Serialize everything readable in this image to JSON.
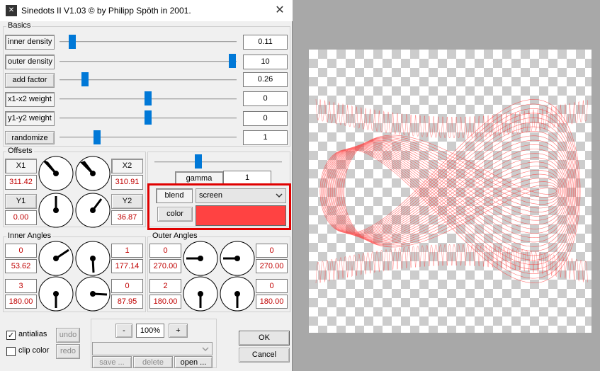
{
  "window": {
    "title": "Sinedots II V1.03 © by Philipp Spöth in 2001.",
    "close_glyph": "✕",
    "logo_glyph": "✕"
  },
  "basics": {
    "label": "Basics",
    "rows": [
      {
        "label": "inner density",
        "value": "0.11",
        "slider": 0.09
      },
      {
        "label": "outer density",
        "value": "10",
        "slider": 1.0
      },
      {
        "label": "add factor",
        "value": "0.26",
        "slider": 0.14
      },
      {
        "label": "x1-x2 weight",
        "value": "0",
        "slider": 0.5
      },
      {
        "label": "y1-y2 weight",
        "value": "0",
        "slider": 0.5
      },
      {
        "label": "randomize",
        "value": "1",
        "slider": 0.2
      }
    ]
  },
  "offsets": {
    "label": "Offsets",
    "x1": {
      "label": "X1",
      "value": "311.42"
    },
    "x2": {
      "label": "X2",
      "value": "310.91"
    },
    "y1": {
      "label": "Y1",
      "value": "0.00"
    },
    "y2": {
      "label": "Y2",
      "value": "36.87"
    }
  },
  "render": {
    "gamma": {
      "label": "gamma",
      "value": "1",
      "slider": 0.45
    },
    "blend": {
      "label": "blend",
      "value": "screen"
    },
    "color": {
      "label": "color",
      "swatch": "#ff4242"
    }
  },
  "inner_angles": {
    "label": "Inner Angles",
    "items": [
      {
        "index": "0",
        "value": "53.62"
      },
      {
        "index": "1",
        "value": "177.14"
      },
      {
        "index": "3",
        "value": "180.00"
      },
      {
        "index": "0",
        "value": "87.95"
      }
    ]
  },
  "outer_angles": {
    "label": "Outer Angles",
    "items": [
      {
        "index": "0",
        "value": "270.00"
      },
      {
        "index": "0",
        "value": "270.00"
      },
      {
        "index": "2",
        "value": "180.00"
      },
      {
        "index": "0",
        "value": "180.00"
      }
    ]
  },
  "options": {
    "antialias": {
      "label": "antialias",
      "checked": true,
      "glyph": "✓"
    },
    "clip_color": {
      "label": "clip color",
      "checked": false
    }
  },
  "history": {
    "undo": "undo",
    "redo": "redo"
  },
  "zoom": {
    "minus": "-",
    "value": "100%",
    "plus": "+"
  },
  "file": {
    "save": "save ...",
    "delete": "delete",
    "open": "open ..."
  },
  "dialog_buttons": {
    "ok": "OK",
    "cancel": "Cancel"
  },
  "colors": {
    "accent": "#0078d7",
    "highlight": "#e00000",
    "value_red": "#c00000",
    "curve": "#ff3030"
  }
}
